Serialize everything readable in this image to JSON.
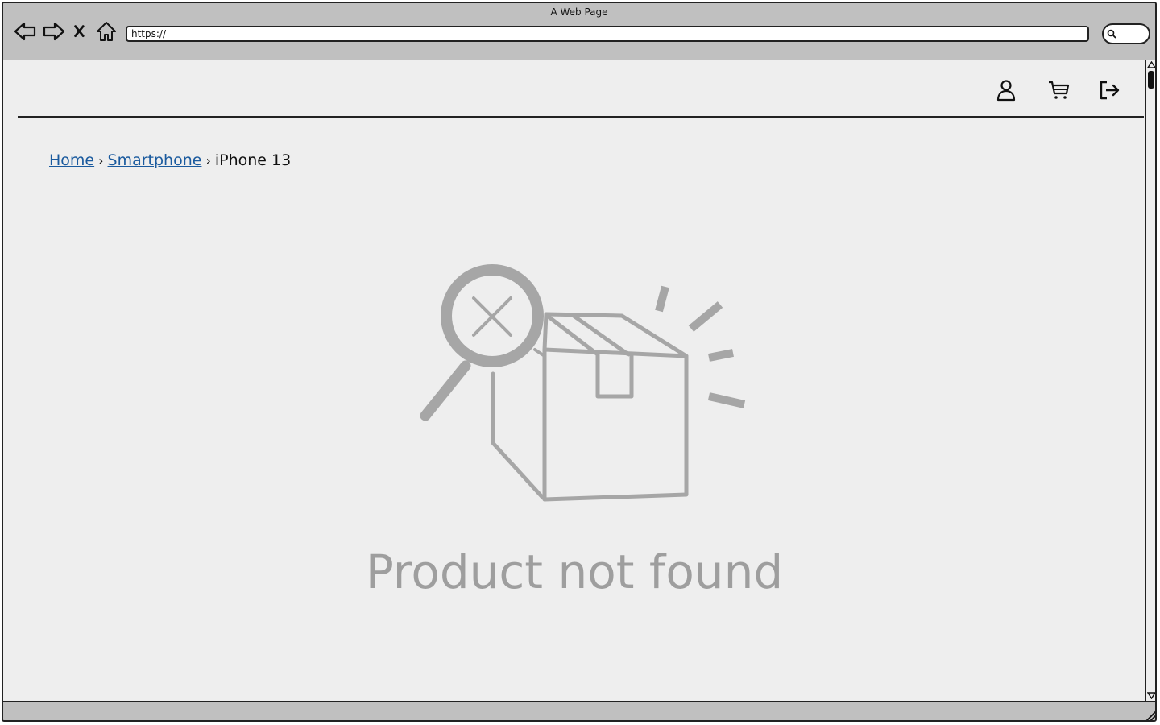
{
  "window": {
    "title": "A Web Page"
  },
  "browser": {
    "url": "https://",
    "nav_icons": [
      "back-arrow-icon",
      "forward-arrow-icon",
      "close-x-icon",
      "home-icon"
    ],
    "search_icon": "search-icon"
  },
  "header": {
    "icons": [
      "user-icon",
      "cart-icon",
      "logout-icon"
    ]
  },
  "breadcrumb": {
    "items": [
      {
        "label": "Home",
        "link": true
      },
      {
        "label": "Smartphone",
        "link": true
      },
      {
        "label": "iPhone 13",
        "link": false
      }
    ],
    "separator": "›"
  },
  "empty_state": {
    "icon": "product-not-found-illustration",
    "message": "Product not found"
  },
  "colors": {
    "link": "#1a5a9e",
    "illustration": "#a6a6a6",
    "message": "#9e9e9e",
    "page_background": "#eeeeee",
    "chrome": "#c0c0c0"
  }
}
